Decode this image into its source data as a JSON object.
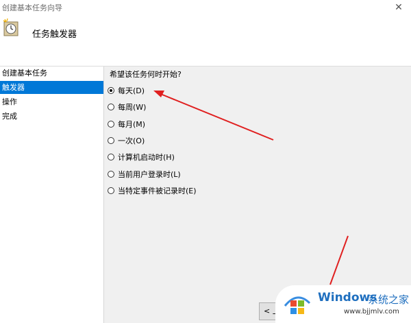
{
  "window": {
    "title": "创建基本任务向导",
    "close_glyph": "✕"
  },
  "header": {
    "title": "任务触发器",
    "icon": "task-clock-icon"
  },
  "sidebar": {
    "items": [
      {
        "label": "创建基本任务",
        "active": false
      },
      {
        "label": "触发器",
        "active": true
      },
      {
        "label": "操作",
        "active": false
      },
      {
        "label": "完成",
        "active": false
      }
    ]
  },
  "trigger": {
    "question": "希望该任务何时开始?",
    "options": [
      {
        "label": "每天(D)",
        "checked": true
      },
      {
        "label": "每周(W)",
        "checked": false
      },
      {
        "label": "每月(M)",
        "checked": false
      },
      {
        "label": "一次(O)",
        "checked": false
      },
      {
        "label": "计算机启动时(H)",
        "checked": false
      },
      {
        "label": "当前用户登录时(L)",
        "checked": false
      },
      {
        "label": "当特定事件被记录时(E)",
        "checked": false
      }
    ]
  },
  "footer": {
    "back_label": "< 上"
  },
  "watermark": {
    "brand": "Windows",
    "site_name": "系统之家",
    "url": "www.bjjmlv.com"
  },
  "colors": {
    "selection": "#0078d7",
    "arrow": "#e02020",
    "brand": "#1f6fbf"
  }
}
